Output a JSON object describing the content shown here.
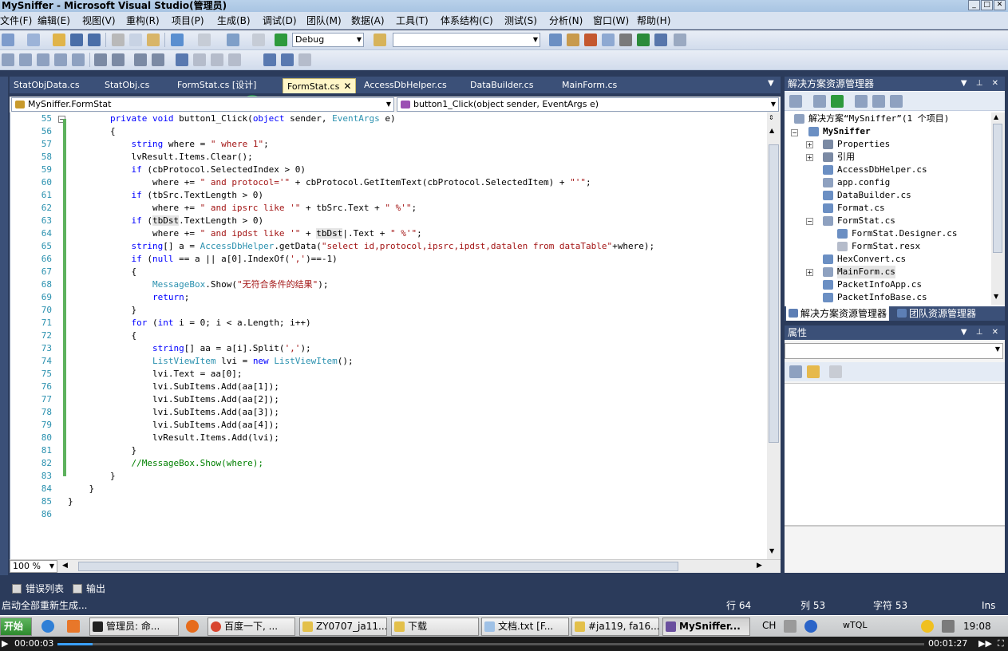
{
  "window": {
    "title": "MySniffer - Microsoft Visual Studio(管理员)"
  },
  "menu": {
    "items": [
      "文件(F)",
      "编辑(E)",
      "视图(V)",
      "重构(R)",
      "项目(P)",
      "生成(B)",
      "调试(D)",
      "团队(M)",
      "数据(A)",
      "工具(T)",
      "体系结构(C)",
      "测试(S)",
      "分析(N)",
      "窗口(W)",
      "帮助(H)"
    ]
  },
  "toolbar": {
    "config_combo": "Debug",
    "search_combo": ""
  },
  "tabs": [
    {
      "label": "StatObjData.cs"
    },
    {
      "label": "StatObj.cs"
    },
    {
      "label": "FormStat.cs [设计]"
    },
    {
      "label": "FormStat.cs",
      "active": true
    },
    {
      "label": "AccessDbHelper.cs"
    },
    {
      "label": "DataBuilder.cs"
    },
    {
      "label": "MainForm.cs"
    }
  ],
  "nav": {
    "class_combo": "MySniffer.FormStat",
    "member_combo": "button1_Click(object sender, EventArgs e)"
  },
  "editor": {
    "line_numbers": [
      "55",
      "56",
      "57",
      "58",
      "59",
      "60",
      "61",
      "62",
      "63",
      "64",
      "65",
      "66",
      "67",
      "68",
      "69",
      "70",
      "71",
      "72",
      "73",
      "74",
      "75",
      "76",
      "77",
      "78",
      "79",
      "80",
      "81",
      "82",
      "83",
      "84",
      "85",
      "86"
    ],
    "zoom": "100 %"
  },
  "solution_explorer": {
    "title": "解决方案资源管理器",
    "root": "解决方案“MySniffer”(1 个项目)",
    "project": "MySniffer",
    "items": [
      "Properties",
      "引用",
      "AccessDbHelper.cs",
      "app.config",
      "DataBuilder.cs",
      "Format.cs",
      "FormStat.cs",
      "FormStat.Designer.cs",
      "FormStat.resx",
      "HexConvert.cs",
      "MainForm.cs",
      "PacketInfoApp.cs",
      "PacketInfoBase.cs"
    ],
    "bottom_tabs": [
      "解决方案资源管理器",
      "团队资源管理器"
    ]
  },
  "properties": {
    "title": "属性"
  },
  "bottom_panels": [
    "错误列表",
    "输出"
  ],
  "status": {
    "message": "启动全部重新生成...",
    "row": "行 64",
    "col": "列 53",
    "char": "字符 53",
    "mode": "Ins"
  },
  "taskbar": {
    "start": "开始",
    "tasks": [
      "管理员: 命...",
      "百度一下, ...",
      "ZY0707_ja11...",
      "下载",
      "文档.txt [F...",
      "#ja119, fa16...",
      "MySniffer..."
    ],
    "tray": {
      "lang": "CH",
      "user": "wTQL",
      "time": "19:08"
    }
  },
  "player": {
    "elapsed": "00:00:03",
    "total": "00:01:27"
  }
}
